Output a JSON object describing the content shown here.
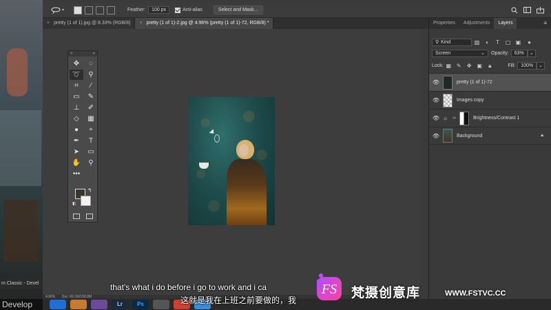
{
  "background_app": {
    "label": "m Classic - Devel",
    "develop_label": "Develop"
  },
  "options_bar": {
    "feather_label": "Feather:",
    "feather_value": "100 px",
    "anti_alias_label": "Anti-alias",
    "anti_alias_checked": true,
    "select_mask_label": "Select and Mask..."
  },
  "tabs": [
    {
      "label": "pretty (1 of 1).jpg @ 8.33% (RGB/8)",
      "active": false
    },
    {
      "label": "pretty (1 of 1)-2.jpg @ 4.96% (pretty (1 of 1)-72, RGB/8) *",
      "active": true
    }
  ],
  "status_bar": {
    "zoom": "4.96%",
    "doc": "Doc: 69.1M/158.8M"
  },
  "panel_tabs": [
    {
      "label": "Properties",
      "active": false
    },
    {
      "label": "Adjustments",
      "active": false
    },
    {
      "label": "Layers",
      "active": true
    }
  ],
  "layers_panel": {
    "kind_label": "Kind",
    "blend_mode": "Screen",
    "opacity_label": "Opacity:",
    "opacity_value": "63%",
    "lock_label": "Lock:",
    "fill_label": "Fill:",
    "fill_value": "100%",
    "layers": [
      {
        "name": "pretty (1 of 1)-72",
        "selected": true,
        "thumb": "photo-dark"
      },
      {
        "name": "Images copy",
        "selected": false,
        "thumb": "transparent"
      },
      {
        "name": "Brightness/Contrast 1",
        "selected": false,
        "thumb": "adjustment"
      },
      {
        "name": "Background",
        "selected": false,
        "thumb": "photo",
        "locked": true
      }
    ]
  },
  "dock": [
    {
      "label": "",
      "color": "#1f6fd8"
    },
    {
      "label": "",
      "color": "#c97a2c"
    },
    {
      "label": "",
      "color": "#6b4a9c"
    },
    {
      "label": "Lr",
      "color": "#1b2a3a"
    },
    {
      "label": "Ps",
      "color": "#0a2a44"
    },
    {
      "label": "",
      "color": "#555"
    },
    {
      "label": "",
      "color": "#d04030"
    },
    {
      "label": "",
      "color": "#3a8cd8"
    }
  ],
  "subtitles": {
    "english": "that's what i do before i go to work and i ca",
    "chinese": "这就是我在上班之前要做的，我"
  },
  "watermark": {
    "logo_text": "FS",
    "brand_text": "梵摄创意库",
    "url": "WWW.FSTVC.CC"
  }
}
